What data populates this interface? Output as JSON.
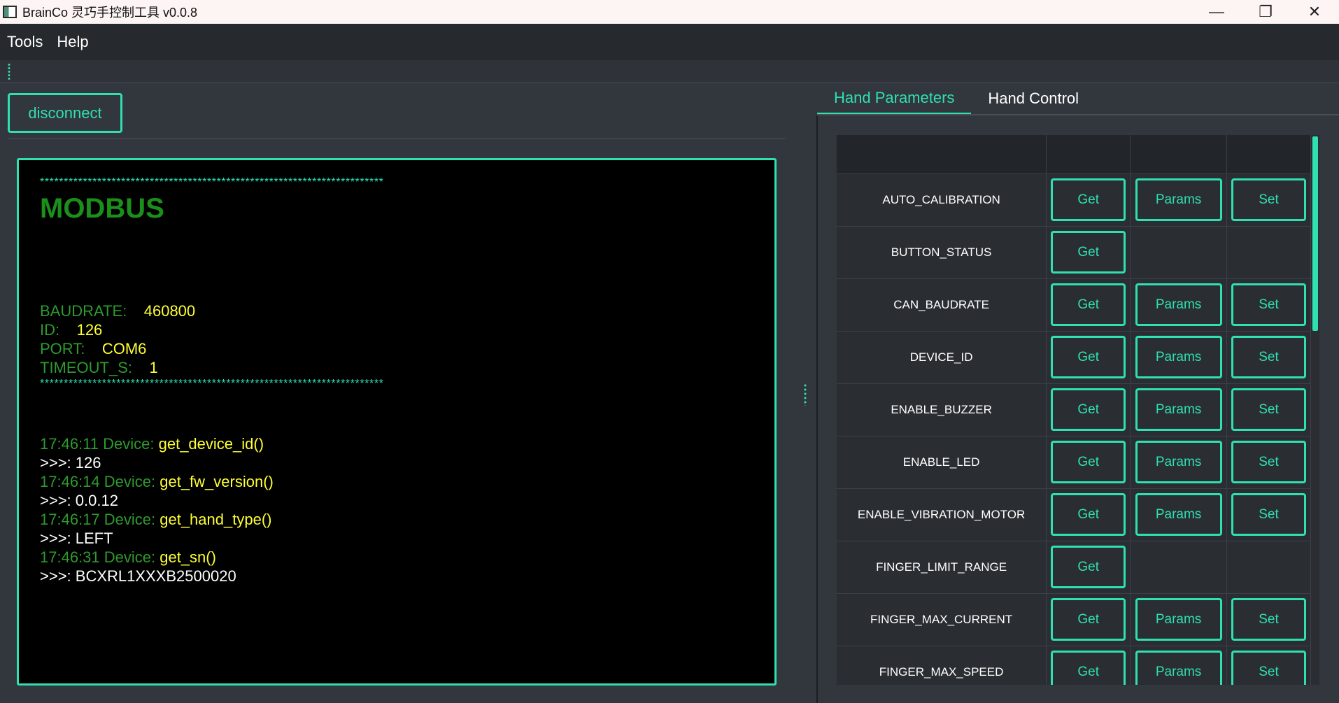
{
  "window": {
    "title": "BrainCo 灵巧手控制工具  v0.0.8",
    "controls": {
      "minimize": "—",
      "restore": "❐",
      "close": "✕"
    }
  },
  "menubar": {
    "items": [
      {
        "label": "Tools"
      },
      {
        "label": "Help"
      }
    ]
  },
  "left": {
    "disconnect_label": "disconnect",
    "console": {
      "stars": "************************************************************************",
      "heading": "MODBUS",
      "params": [
        {
          "key": "BAUDRATE:",
          "value": "460800"
        },
        {
          "key": "ID:",
          "value": "126"
        },
        {
          "key": "PORT:",
          "value": "COM6"
        },
        {
          "key": "TIMEOUT_S:",
          "value": "1"
        }
      ],
      "log": [
        {
          "time": "17:46:11 Device:",
          "cmd": "get_device_id()",
          "result": ">>>: 126"
        },
        {
          "time": "17:46:14 Device:",
          "cmd": "get_fw_version()",
          "result": ">>>: 0.0.12"
        },
        {
          "time": "17:46:17 Device:",
          "cmd": "get_hand_type()",
          "result": ">>>: LEFT"
        },
        {
          "time": "17:46:31 Device:",
          "cmd": "get_sn()",
          "result": ">>>: BCXRL1XXXB2500020"
        }
      ]
    }
  },
  "right": {
    "tabs": [
      {
        "label": "Hand Parameters",
        "active": true
      },
      {
        "label": "Hand Control",
        "active": false
      }
    ],
    "buttons": {
      "get": "Get",
      "params": "Params",
      "set": "Set"
    },
    "rows": [
      {
        "name": "AUTO_CALIBRATION",
        "get": true,
        "params": true,
        "set": true
      },
      {
        "name": "BUTTON_STATUS",
        "get": true,
        "params": false,
        "set": false
      },
      {
        "name": "CAN_BAUDRATE",
        "get": true,
        "params": true,
        "set": true
      },
      {
        "name": "DEVICE_ID",
        "get": true,
        "params": true,
        "set": true
      },
      {
        "name": "ENABLE_BUZZER",
        "get": true,
        "params": true,
        "set": true
      },
      {
        "name": "ENABLE_LED",
        "get": true,
        "params": true,
        "set": true
      },
      {
        "name": "ENABLE_VIBRATION_MOTOR",
        "get": true,
        "params": true,
        "set": true
      },
      {
        "name": "FINGER_LIMIT_RANGE",
        "get": true,
        "params": false,
        "set": false
      },
      {
        "name": "FINGER_MAX_CURRENT",
        "get": true,
        "params": true,
        "set": true
      },
      {
        "name": "FINGER_MAX_SPEED",
        "get": true,
        "params": true,
        "set": true
      }
    ]
  },
  "colors": {
    "accent": "#2fe0b0",
    "background": "#32363d",
    "console_bg": "#000000",
    "console_key": "#2e9a2e",
    "console_value": "#ffff33"
  }
}
